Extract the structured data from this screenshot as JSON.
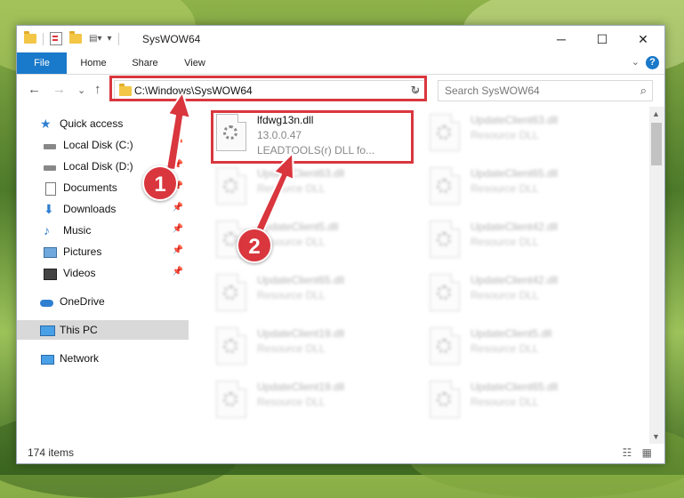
{
  "window": {
    "title": "SysWOW64",
    "minimize_glyph": "─",
    "maximize_glyph": "☐",
    "close_glyph": "✕"
  },
  "ribbon": {
    "tabs": [
      "File",
      "Home",
      "Share",
      "View"
    ],
    "help_glyph": "?",
    "collapse_glyph": "⌄"
  },
  "navigation": {
    "back_glyph": "←",
    "forward_glyph": "→",
    "recent_glyph": "⌄",
    "up_glyph": "↑",
    "address": "C:\\Windows\\SysWOW64",
    "address_dropdown_glyph": "⌄",
    "refresh_glyph": "↻",
    "search_placeholder": "Search SysWOW64",
    "search_glyph": "⌕"
  },
  "sidebar": {
    "items": [
      {
        "label": "Quick access",
        "icon": "star-icon"
      },
      {
        "label": "Local Disk (C:)",
        "icon": "drive-icon",
        "pinned": true
      },
      {
        "label": "Local Disk (D:)",
        "icon": "drive-icon",
        "pinned": true
      },
      {
        "label": "Documents",
        "icon": "documents-icon",
        "pinned": true
      },
      {
        "label": "Downloads",
        "icon": "download-icon",
        "pinned": true
      },
      {
        "label": "Music",
        "icon": "music-icon",
        "pinned": true
      },
      {
        "label": "Pictures",
        "icon": "pictures-icon",
        "pinned": true
      },
      {
        "label": "Videos",
        "icon": "videos-icon",
        "pinned": true
      },
      {
        "label": "OneDrive",
        "icon": "cloud-icon"
      },
      {
        "label": "This PC",
        "icon": "computer-icon",
        "selected": true
      },
      {
        "label": "Network",
        "icon": "network-icon"
      }
    ],
    "pin_glyph": "📌"
  },
  "files": [
    {
      "name": "lfdwg13n.dll",
      "version": "13.0.0.47",
      "description": "LEADTOOLS(r) DLL fo..."
    },
    {
      "name": "UpdateClient63.dll",
      "version": "Resource DLL"
    },
    {
      "name": "UpdateClient63.dll",
      "version": "Resource DLL"
    },
    {
      "name": "UpdateClient65.dll",
      "version": "Resource DLL"
    },
    {
      "name": "UpdateClient5.dll",
      "version": "Resource DLL"
    },
    {
      "name": "UpdateClient42.dll",
      "version": "Resource DLL"
    },
    {
      "name": "UpdateClient65.dll",
      "version": "Resource DLL"
    },
    {
      "name": "UpdateClient42.dll",
      "version": "Resource DLL"
    },
    {
      "name": "UpdateClient19.dll",
      "version": "Resource DLL"
    },
    {
      "name": "UpdateClient5.dll",
      "version": "Resource DLL"
    },
    {
      "name": "UpdateClient19.dll",
      "version": "Resource DLL"
    },
    {
      "name": "UpdateClient65.dll",
      "version": "Resource DLL"
    }
  ],
  "status": {
    "item_count": "174 items",
    "view_glyphs": "☷ ▦"
  },
  "annotations": {
    "step1": "1",
    "step2": "2",
    "color": "#d9363e"
  },
  "colors": {
    "accent": "#1979ca",
    "selection": "#d9d9d9"
  }
}
